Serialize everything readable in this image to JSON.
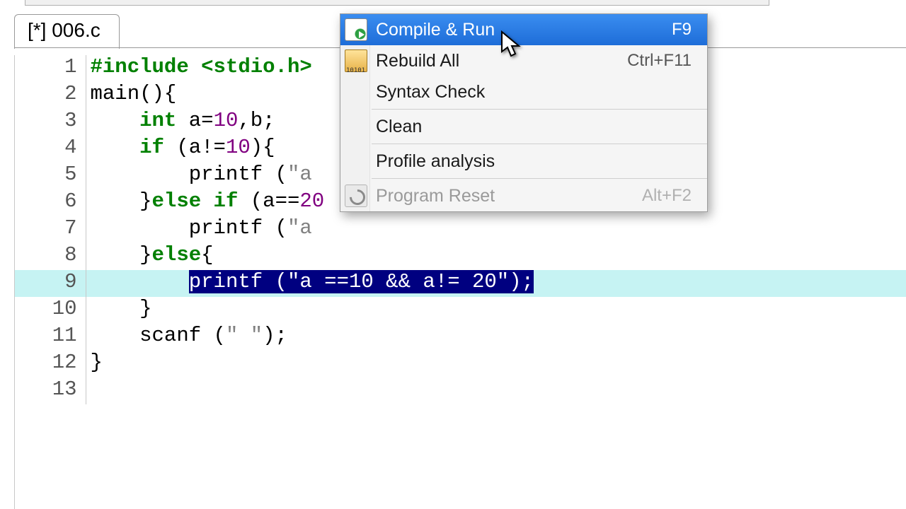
{
  "tab": {
    "title": "[*] 006.c"
  },
  "code": {
    "lines": [
      {
        "n": 1,
        "tokens": [
          [
            "kw",
            "#include"
          ],
          [
            "",
            ""
          ],
          [
            "",
            " "
          ],
          [
            "kw",
            "<stdio.h>"
          ]
        ]
      },
      {
        "n": 2,
        "tokens": [
          [
            "",
            "main(){"
          ]
        ]
      },
      {
        "n": 3,
        "tokens": [
          [
            "",
            "    "
          ],
          [
            "kw",
            "int"
          ],
          [
            "",
            " a="
          ],
          [
            "num",
            "10"
          ],
          [
            "",
            ",b;"
          ]
        ]
      },
      {
        "n": 4,
        "tokens": [
          [
            "",
            "    "
          ],
          [
            "kw",
            "if"
          ],
          [
            "",
            " (a!="
          ],
          [
            "num",
            "10"
          ],
          [
            "",
            ")"
          ],
          [
            "",
            "{"
          ]
        ]
      },
      {
        "n": 5,
        "tokens": [
          [
            "",
            "        printf ("
          ],
          [
            "str",
            "\"a "
          ]
        ]
      },
      {
        "n": 6,
        "tokens": [
          [
            "",
            "    }"
          ],
          [
            "kw",
            "else"
          ],
          [
            "",
            " "
          ],
          [
            "kw",
            "if"
          ],
          [
            "",
            " (a=="
          ],
          [
            "num",
            "20"
          ]
        ]
      },
      {
        "n": 7,
        "tokens": [
          [
            "",
            "        printf ("
          ],
          [
            "str",
            "\"a "
          ]
        ]
      },
      {
        "n": 8,
        "tokens": [
          [
            "",
            "    }"
          ],
          [
            "kw",
            "else"
          ],
          [
            "",
            "{"
          ]
        ]
      },
      {
        "n": 9,
        "tokens": [
          [
            "",
            "        "
          ],
          [
            "sel",
            "printf (\"a ==10 && a!= 20\");"
          ]
        ],
        "current": true
      },
      {
        "n": 10,
        "tokens": [
          [
            "",
            "    }"
          ]
        ]
      },
      {
        "n": 11,
        "tokens": [
          [
            "",
            "    scanf ("
          ],
          [
            "str",
            "\" \""
          ],
          [
            "",
            ");"
          ]
        ]
      },
      {
        "n": 12,
        "tokens": [
          [
            "",
            "}"
          ]
        ]
      },
      {
        "n": 13,
        "tokens": [
          [
            "",
            ""
          ]
        ]
      }
    ]
  },
  "menu": {
    "items": [
      {
        "id": "compile-run",
        "label": "Compile & Run",
        "shortcut": "F9",
        "icon": "icon-compile",
        "highlight": true
      },
      {
        "id": "rebuild-all",
        "label": "Rebuild All",
        "shortcut": "Ctrl+F11",
        "icon": "icon-rebuild"
      },
      {
        "id": "syntax-check",
        "label": "Syntax Check",
        "shortcut": ""
      },
      {
        "sep": true
      },
      {
        "id": "clean",
        "label": "Clean",
        "shortcut": ""
      },
      {
        "sep": true
      },
      {
        "id": "profile",
        "label": "Profile analysis",
        "shortcut": ""
      },
      {
        "sep": true
      },
      {
        "id": "program-reset",
        "label": "Program Reset",
        "shortcut": "Alt+F2",
        "icon": "icon-reset",
        "disabled": true
      }
    ]
  }
}
